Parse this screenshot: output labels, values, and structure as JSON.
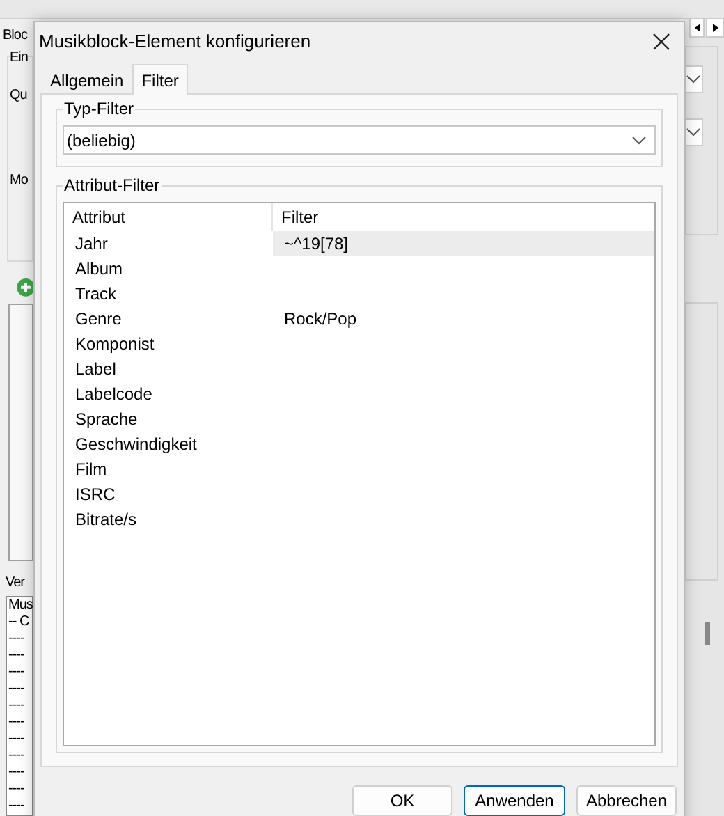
{
  "background": {
    "tab": "Bloc",
    "group": "Ein",
    "labels": [
      "Qu",
      "Mo"
    ],
    "section": "Ver",
    "list_lines": [
      "Mus",
      "-- C",
      "----",
      "----",
      "----",
      "----",
      "----",
      "----",
      "----",
      "----",
      "----",
      "----",
      "----"
    ]
  },
  "dialog": {
    "title": "Musikblock-Element konfigurieren",
    "tabs": [
      {
        "label": "Allgemein",
        "selected": false
      },
      {
        "label": "Filter",
        "selected": true
      }
    ],
    "typ_filter": {
      "label": "Typ-Filter",
      "value": "(beliebig)"
    },
    "attribut_filter": {
      "label": "Attribut-Filter",
      "columns": [
        "Attribut",
        "Filter"
      ],
      "rows": [
        {
          "attribut": "Jahr",
          "filter": "~^19[78]",
          "selected": true
        },
        {
          "attribut": "Album",
          "selected": false
        },
        {
          "attribut": "Track",
          "selected": false
        },
        {
          "attribut": "Genre",
          "filter": "Rock/Pop",
          "selected": false
        },
        {
          "attribut": "Komponist",
          "selected": false
        },
        {
          "attribut": "Label",
          "selected": false
        },
        {
          "attribut": "Labelcode",
          "selected": false
        },
        {
          "attribut": "Sprache",
          "selected": false
        },
        {
          "attribut": "Geschwindigkeit",
          "selected": false
        },
        {
          "attribut": "Film",
          "selected": false
        },
        {
          "attribut": "ISRC",
          "selected": false
        },
        {
          "attribut": "Bitrate/s",
          "selected": false
        }
      ]
    },
    "buttons": [
      {
        "label": "OK",
        "focused": false
      },
      {
        "label": "Anwenden",
        "focused": true
      },
      {
        "label": "Abbrechen",
        "focused": false
      }
    ]
  }
}
